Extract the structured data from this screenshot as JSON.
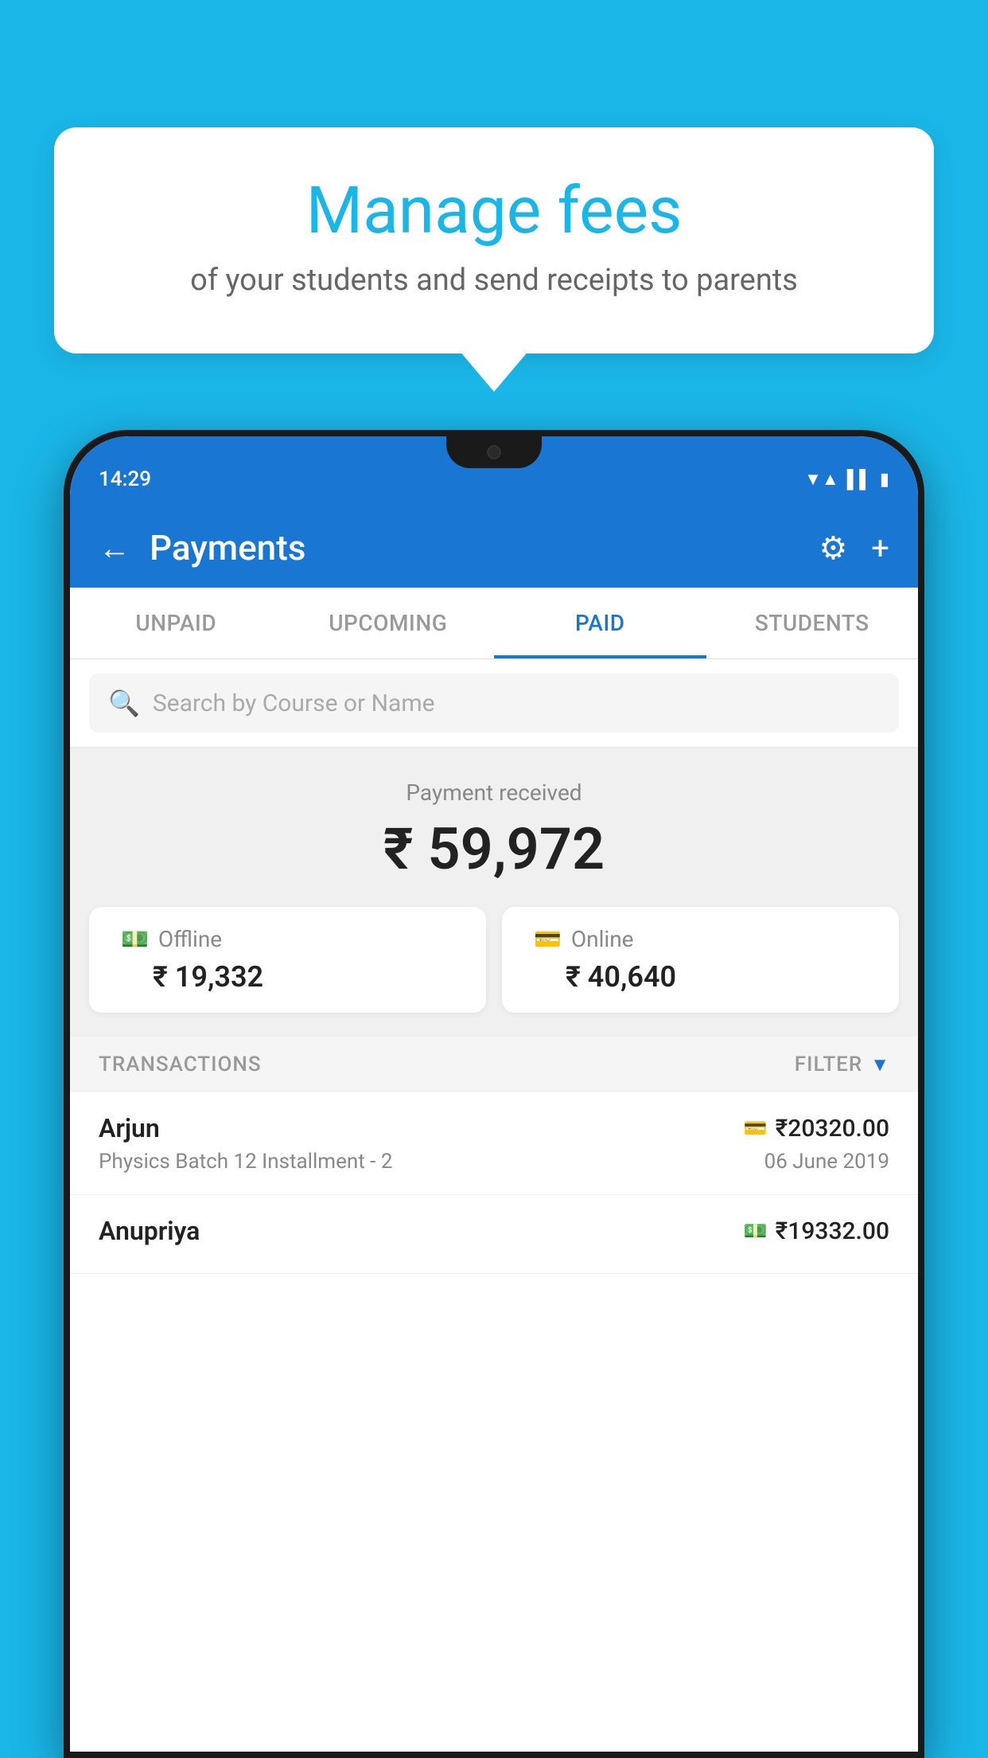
{
  "bubble": {
    "title": "Manage fees",
    "subtitle": "of your students and send receipts to parents"
  },
  "phone": {
    "status": {
      "time": "14:29"
    },
    "header": {
      "title": "Payments",
      "back_label": "←",
      "gear_label": "⚙",
      "plus_label": "+"
    },
    "tabs": [
      {
        "label": "UNPAID",
        "active": false
      },
      {
        "label": "UPCOMING",
        "active": false
      },
      {
        "label": "PAID",
        "active": true
      },
      {
        "label": "STUDENTS",
        "active": false
      }
    ],
    "search": {
      "placeholder": "Search by Course or Name"
    },
    "payment_summary": {
      "label": "Payment received",
      "amount": "₹ 59,972",
      "offline": {
        "label": "Offline",
        "amount": "₹ 19,332"
      },
      "online": {
        "label": "Online",
        "amount": "₹ 40,640"
      }
    },
    "transactions": {
      "header_label": "TRANSACTIONS",
      "filter_label": "FILTER",
      "items": [
        {
          "name": "Arjun",
          "course": "Physics Batch 12 Installment - 2",
          "amount": "₹20320.00",
          "date": "06 June 2019",
          "payment_type": "card"
        },
        {
          "name": "Anupriya",
          "course": "",
          "amount": "₹19332.00",
          "date": "",
          "payment_type": "cash"
        }
      ]
    }
  },
  "colors": {
    "primary": "#1976d2",
    "accent": "#1ab6e8",
    "background": "#1ab6e8"
  }
}
